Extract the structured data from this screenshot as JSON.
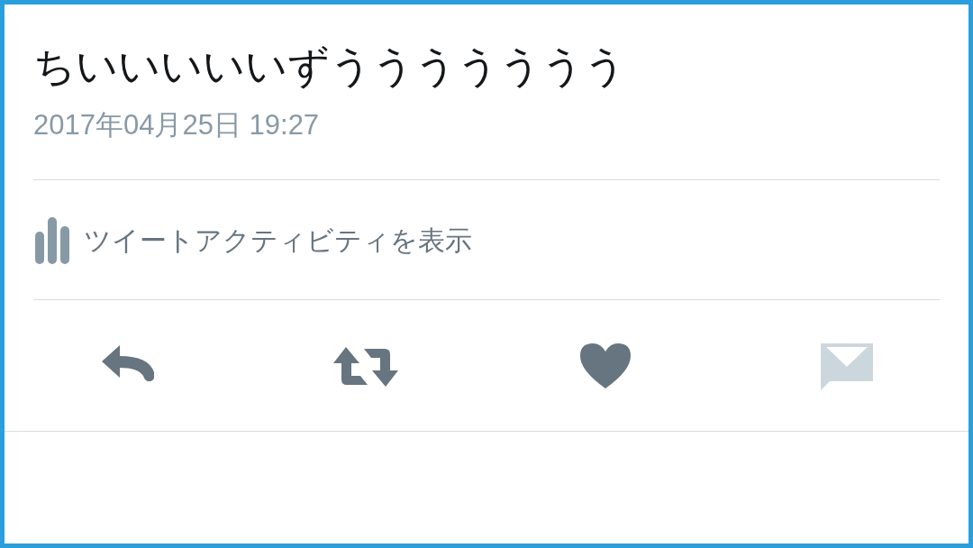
{
  "tweet": {
    "text": "ちいいいいいずううううううう",
    "timestamp": "2017年04月25日 19:27"
  },
  "activity_link": {
    "label": "ツイートアクティビティを表示"
  },
  "actions": [
    {
      "kind": "reply",
      "disabled": false
    },
    {
      "kind": "retweet",
      "disabled": false
    },
    {
      "kind": "like",
      "disabled": false
    },
    {
      "kind": "message",
      "disabled": true
    }
  ]
}
